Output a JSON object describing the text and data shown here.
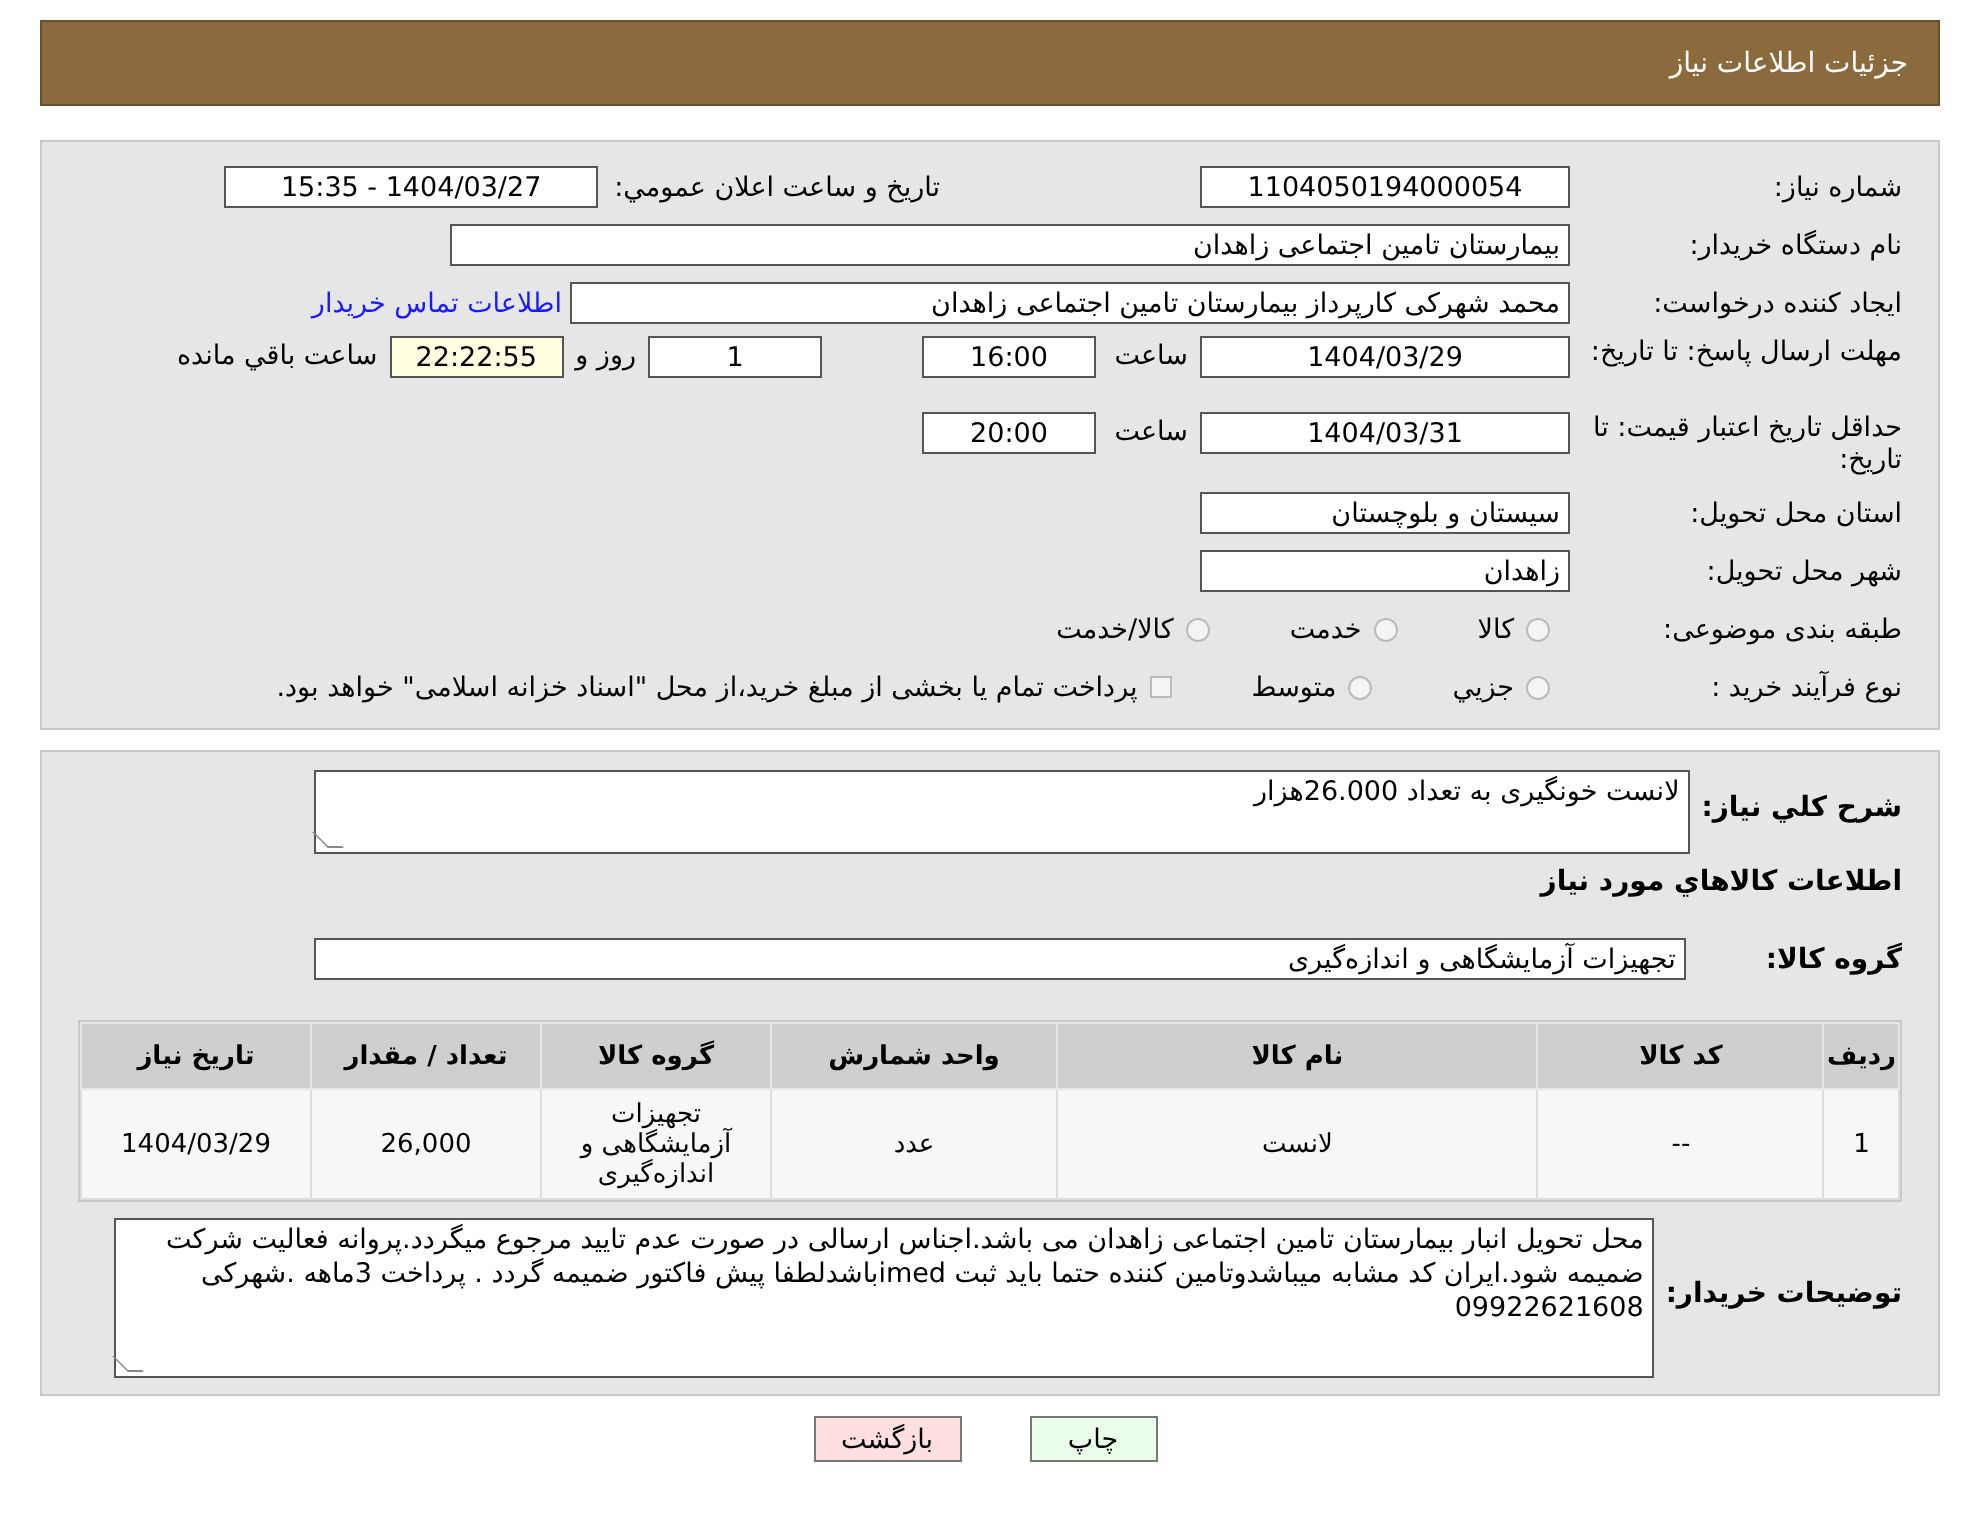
{
  "header": {
    "title": "جزئیات اطلاعات نیاز"
  },
  "details": {
    "need_number": {
      "label": "شماره نياز:",
      "value": "1104050194000054"
    },
    "announce": {
      "label": "تاريخ و ساعت اعلان عمومي:",
      "value": "1404/03/27 - 15:35"
    },
    "buyer_org": {
      "label": "نام دستگاه خريدار:",
      "value": "بيمارستان تامين اجتماعی زاهدان"
    },
    "requester": {
      "label": "ايجاد کننده درخواست:",
      "value": "محمد شهرکی کارپرداز بيمارستان تامين اجتماعی زاهدان",
      "link": "اطلاعات تماس خريدار"
    },
    "deadline": {
      "label": "مهلت ارسال پاسخ: تا تاريخ:",
      "date": "1404/03/29",
      "time_label": "ساعت",
      "time": "16:00",
      "days": "1",
      "days_label": "روز و",
      "remaining": "22:22:55",
      "remaining_label": "ساعت باقي مانده"
    },
    "validity": {
      "label": "حداقل تاريخ اعتبار قيمت: تا تاريخ:",
      "date": "1404/03/31",
      "time_label": "ساعت",
      "time": "20:00"
    },
    "province": {
      "label": "استان محل تحويل:",
      "value": "سيستان و بلوچستان"
    },
    "city": {
      "label": "شهر محل تحويل:",
      "value": "زاهدان"
    },
    "category": {
      "label": "طبقه بندی موضوعی:",
      "options": [
        {
          "label": "کالا",
          "selected": false
        },
        {
          "label": "خدمت",
          "selected": false
        },
        {
          "label": "کالا/خدمت",
          "selected": false
        }
      ]
    },
    "purchase_type": {
      "label": "نوع فرآيند خريد :",
      "options": [
        {
          "label": "جزيي",
          "selected": false
        },
        {
          "label": "متوسط",
          "selected": false
        }
      ],
      "treasury": {
        "label": "پرداخت تمام يا بخشی از مبلغ خريد،از محل \"اسناد خزانه اسلامی\" خواهد بود.",
        "checked": false
      }
    }
  },
  "description": {
    "label": "شرح كلي نياز:",
    "value": "لانست خونگيری به تعداد 26.000هزار"
  },
  "goods_title": "اطلاعات كالاهاي مورد نياز",
  "goods_group": {
    "label": "گروه کالا:",
    "value": "تجهيزات آزمايشگاهی و اندازه‌گيری"
  },
  "table": {
    "columns": [
      "رديف",
      "کد کالا",
      "نام کالا",
      "واحد شمارش",
      "گروه کالا",
      "تعداد / مقدار",
      "تاريخ نياز"
    ],
    "rows": [
      [
        "1",
        "--",
        "لانست",
        "عدد",
        "تجهيزات آزمايشگاهی و اندازه‌گيری",
        "26,000",
        "1404/03/29"
      ]
    ]
  },
  "buyer_notes": {
    "label": "توضيحات خريدار:",
    "value": "محل تحويل انبار بيمارستان تامين اجتماعی زاهدان می باشد.اجناس ارسالی در صورت عدم تاييد مرجوع ميگردد.پروانه فعاليت شرکت ضميمه شود.ايران کد مشابه ميباشدوتامين کننده حتما بايد ثبت imedباشدلطفا پيش فاکتور ضميمه گردد . پرداخت 3ماهه  .شهرکی 09922621608"
  },
  "buttons": [
    {
      "label": "چاپ",
      "kind": "print"
    },
    {
      "label": "بازگشت",
      "kind": "back"
    }
  ]
}
